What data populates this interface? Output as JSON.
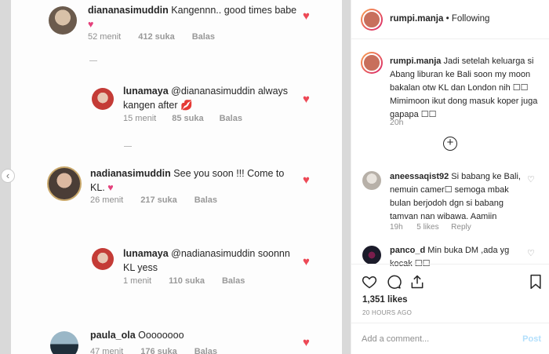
{
  "screenshot": {
    "comments": [
      {
        "username": "diananasimuddin",
        "text": "Kangennn.. good times babe",
        "emoji": "♥",
        "time": "52 menit",
        "likes": "412 suka",
        "reply": "Balas"
      },
      {
        "username": "lunamaya",
        "text": "@diananasimuddin always kangen after",
        "emoji": "💋",
        "time": "15 menit",
        "likes": "85 suka",
        "reply": "Balas"
      },
      {
        "username": "nadianasimuddin",
        "text": "See you soon !!! Come to KL.",
        "emoji": "♥",
        "time": "26 menit",
        "likes": "217 suka",
        "reply": "Balas"
      },
      {
        "username": "lunamaya",
        "text": "@nadianasimuddin soonnn KL yess",
        "time": "1 menit",
        "likes": "110 suka",
        "reply": "Balas"
      },
      {
        "username": "paula_ola",
        "text": "Oooooooo",
        "time": "47 menit",
        "likes": "176 suka",
        "reply": "Balas"
      }
    ],
    "prev_icon": "chevron-left-icon"
  },
  "post": {
    "header_username": "rumpi.manja",
    "header_separator": "•",
    "header_follow": "Following",
    "caption_username": "rumpi.manja",
    "caption_text": "Jadi setelah keluarga si Abang liburan ke Bali soon my moon bakalan otw KL dan London nih ☐☐ Mimimoon ikut dong masuk koper juga gapapa ☐☐",
    "caption_time": "20h",
    "load_more_icon": "plus-circle-icon",
    "comments": [
      {
        "username": "aneessaqist92",
        "text": "Si babang ke Bali, nemuin camer☐ semoga mbak bulan berjodoh dgn si babang tamvan nan wibawa. Aamiin",
        "time": "19h",
        "likes": "5 likes",
        "reply": "Reply"
      },
      {
        "username": "panco_d",
        "text": "Min buka DM ,ada yg kocak ☐☐"
      }
    ],
    "likes_count": "1,351 likes",
    "timestamp": "20 HOURS AGO",
    "add_comment_placeholder": "Add a comment...",
    "post_button": "Post"
  }
}
